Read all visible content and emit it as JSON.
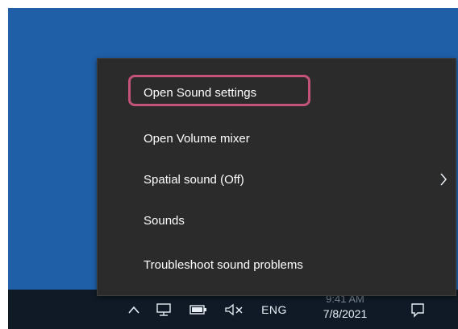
{
  "context_menu": {
    "items": [
      {
        "label": "Open Sound settings",
        "highlighted": true
      },
      {
        "label": "Open Volume mixer"
      },
      {
        "label": "Spatial sound (Off)",
        "has_submenu": true
      },
      {
        "label": "Sounds"
      },
      {
        "label": "Troubleshoot sound problems"
      }
    ],
    "highlight_color": "#c4537a",
    "background_color": "#2b2b2b"
  },
  "taskbar": {
    "language": "ENG",
    "date": "7/8/2021",
    "time_partial": "9:41 AM",
    "icons": [
      "chevron-up-icon",
      "network-icon",
      "battery-icon",
      "volume-muted-icon",
      "notification-icon"
    ]
  },
  "colors": {
    "desktop": "#1f5fa8",
    "taskbar": "#101a26",
    "text": "#ffffff"
  }
}
